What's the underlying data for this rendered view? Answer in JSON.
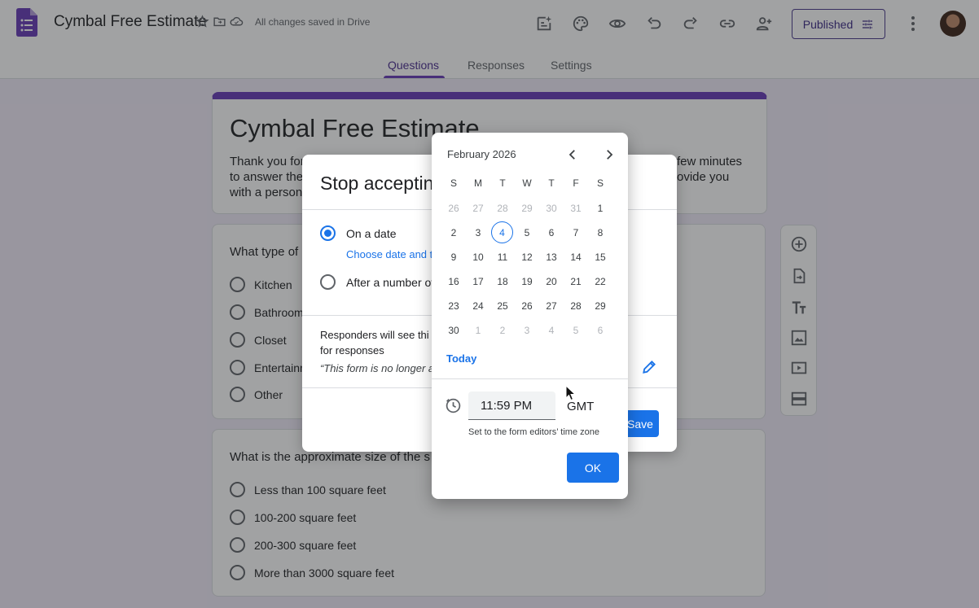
{
  "app": {
    "doc_title": "Cymbal Free Estimate",
    "save_status": "All changes saved in Drive",
    "publish_label": "Published",
    "colors": {
      "accent": "#673ab7",
      "primary": "#1a73e8",
      "background": "#f0ebf8"
    }
  },
  "tabs": [
    {
      "label": "Questions",
      "active": true
    },
    {
      "label": "Responses",
      "active": false
    },
    {
      "label": "Settings",
      "active": false
    }
  ],
  "form": {
    "title": "Cymbal Free Estimate",
    "description_left": "Thank you for\nto answer the\nwith a person",
    "description_right": "few minutes\novide you",
    "q1": {
      "title": "What type of",
      "options": [
        "Kitchen",
        "Bathroom",
        "Closet",
        "Entertainn",
        "Other"
      ]
    },
    "q2": {
      "title": "What is the approximate size of the s",
      "options": [
        "Less than 100 square feet",
        "100-200 square feet",
        "200-300 square feet",
        "More than 3000 square feet"
      ]
    }
  },
  "dialog": {
    "title": "Stop acceptin",
    "option_date": "On a date",
    "choose_link": "Choose date and t",
    "option_count": "After a number of",
    "responders_text": "Responders will see thi for responses",
    "closed_message": "“This form is no longer a",
    "save_label": "Save"
  },
  "picker": {
    "month": "February 2026",
    "weekdays": [
      "S",
      "M",
      "T",
      "W",
      "T",
      "F",
      "S"
    ],
    "days": [
      {
        "d": "26",
        "m": true
      },
      {
        "d": "27",
        "m": true
      },
      {
        "d": "28",
        "m": true
      },
      {
        "d": "29",
        "m": true
      },
      {
        "d": "30",
        "m": true
      },
      {
        "d": "31",
        "m": true
      },
      {
        "d": "1"
      },
      {
        "d": "2"
      },
      {
        "d": "3"
      },
      {
        "d": "4",
        "s": true
      },
      {
        "d": "5"
      },
      {
        "d": "6"
      },
      {
        "d": "7"
      },
      {
        "d": "8"
      },
      {
        "d": "9"
      },
      {
        "d": "10"
      },
      {
        "d": "11"
      },
      {
        "d": "12"
      },
      {
        "d": "13"
      },
      {
        "d": "14"
      },
      {
        "d": "15"
      },
      {
        "d": "16"
      },
      {
        "d": "17"
      },
      {
        "d": "18"
      },
      {
        "d": "19"
      },
      {
        "d": "20"
      },
      {
        "d": "21"
      },
      {
        "d": "22"
      },
      {
        "d": "23"
      },
      {
        "d": "24"
      },
      {
        "d": "25"
      },
      {
        "d": "26"
      },
      {
        "d": "27"
      },
      {
        "d": "28"
      },
      {
        "d": "29"
      },
      {
        "d": "30"
      },
      {
        "d": "1",
        "m": true
      },
      {
        "d": "2",
        "m": true
      },
      {
        "d": "3",
        "m": true
      },
      {
        "d": "4",
        "m": true
      },
      {
        "d": "5",
        "m": true
      },
      {
        "d": "6",
        "m": true
      }
    ],
    "today_label": "Today",
    "time_value": "11:59 PM",
    "timezone": "GMT",
    "timezone_note": "Set to the form editors’ time zone",
    "ok_label": "OK"
  }
}
